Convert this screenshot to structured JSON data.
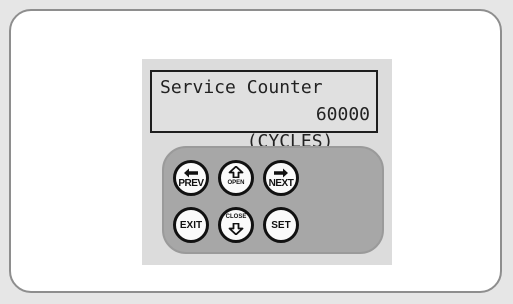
{
  "display": {
    "line1": "Service Counter",
    "line2_label": "(CYCLES)",
    "line2_value": "60000"
  },
  "keys": {
    "prev": "PREV",
    "open": "OPEN",
    "next": "NEXT",
    "exit": "EXIT",
    "close": "CLOSE",
    "set": "SET"
  },
  "icons": {
    "prev": "arrow-left-icon",
    "open": "arrow-up-icon",
    "next": "arrow-right-icon",
    "close": "arrow-down-icon"
  }
}
